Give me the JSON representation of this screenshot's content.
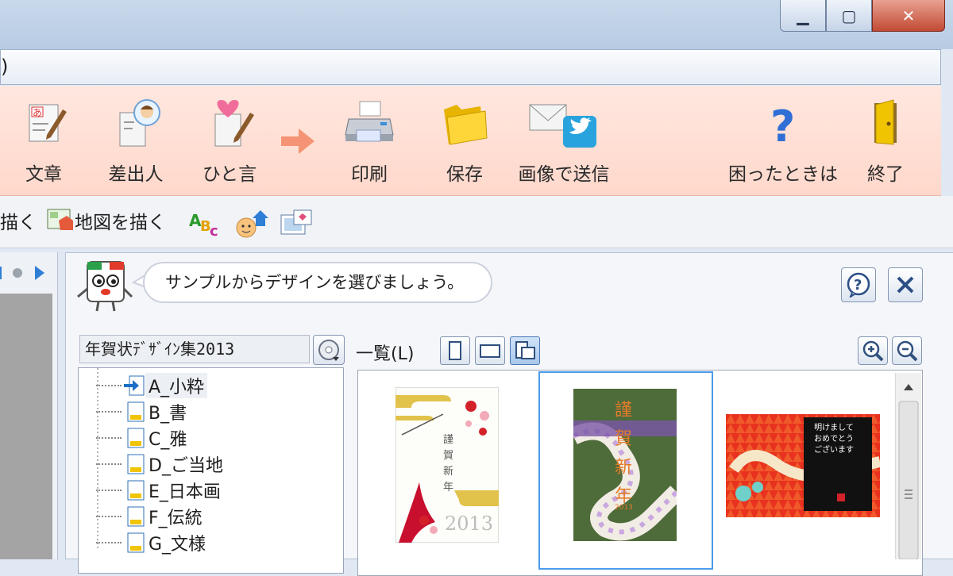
{
  "window": {
    "min_glyph": "▁",
    "max_glyph": "▢",
    "close_glyph": "✕"
  },
  "menubar": {
    "fragment": ")"
  },
  "toolbar": {
    "items": [
      {
        "label": "文章",
        "icon": "text-edit-icon"
      },
      {
        "label": "差出人",
        "icon": "sender-icon"
      },
      {
        "label": "ひと言",
        "icon": "message-icon"
      },
      {
        "label": "印刷",
        "icon": "printer-icon"
      },
      {
        "label": "保存",
        "icon": "folder-icon"
      },
      {
        "label": "画像で送信",
        "icon": "send-image-icon"
      },
      {
        "label": "困ったときは",
        "icon": "help-icon"
      },
      {
        "label": "終了",
        "icon": "exit-door-icon"
      }
    ]
  },
  "subtoolbar": {
    "partial_label": "描く",
    "map_label": "地図を描く"
  },
  "assistant": {
    "message": "サンプルからデザインを選びましょう。"
  },
  "collection": {
    "selected": "年賀状ﾃﾞｻﾞｲﾝ集2013"
  },
  "tree": {
    "items": [
      "A_小粋",
      "B_書",
      "C_雅",
      "D_ご当地",
      "E_日本画",
      "F_伝統",
      "G_文様"
    ]
  },
  "list": {
    "label": "一覧(L)"
  },
  "thumbnails": [
    {
      "title_lines": [
        "謹",
        "賀",
        "新",
        "年"
      ],
      "year": "2013"
    },
    {
      "title_lines": [
        "謹",
        "賀",
        "新",
        "年"
      ],
      "year": "2013"
    },
    {
      "title_lines": [
        "明けまして",
        "おめでとう",
        "ございます"
      ]
    }
  ],
  "colors": {
    "toolbar_bg": "#ffd8cb",
    "selection_border": "#4b9be9",
    "close_button": "#c24a34"
  }
}
